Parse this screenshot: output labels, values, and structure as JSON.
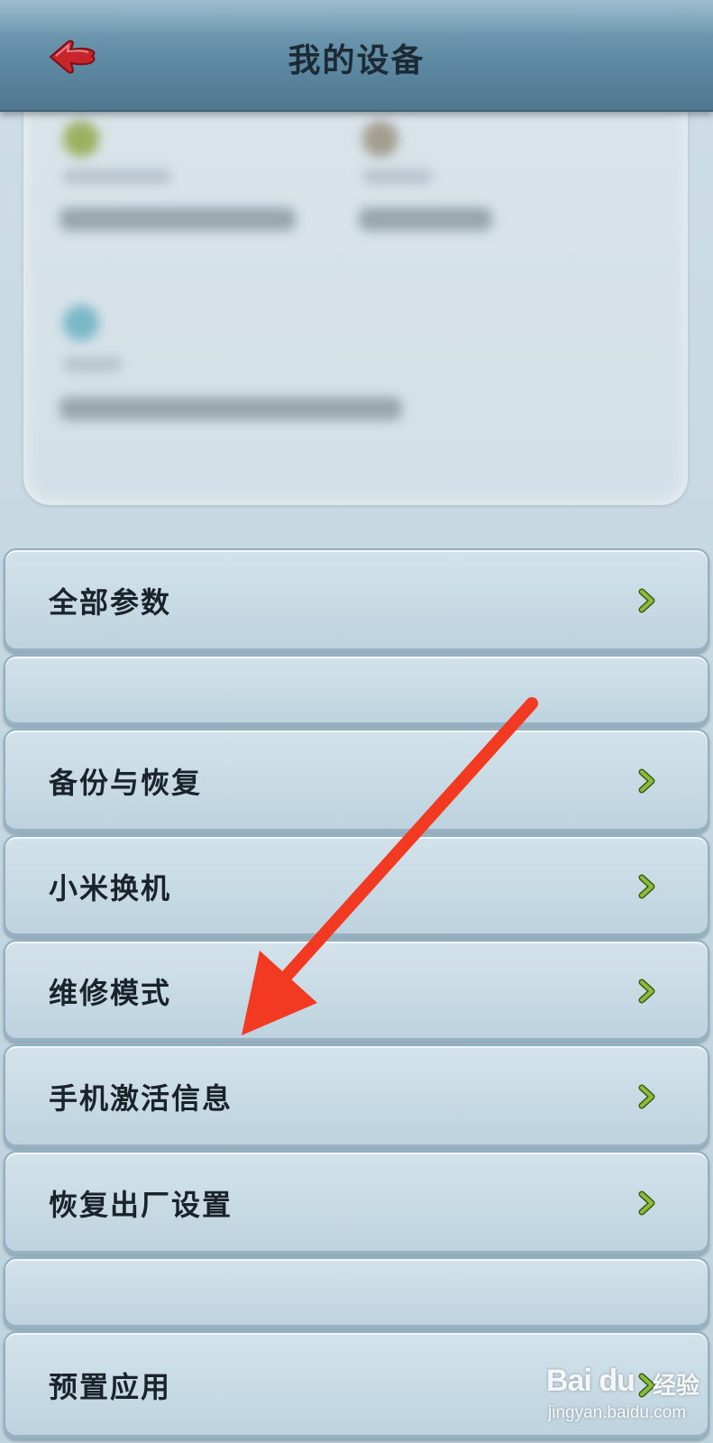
{
  "header": {
    "title": "我的设备",
    "back_icon": "back-arrow-icon",
    "accent_color": "#c8242b"
  },
  "device_card": {
    "note": ""
  },
  "menu": {
    "items": [
      {
        "label": "全部参数",
        "icon": "chevron-right-icon"
      },
      {
        "label": "",
        "icon": ""
      },
      {
        "label": "备份与恢复",
        "icon": "chevron-right-icon"
      },
      {
        "label": "小米换机",
        "icon": "chevron-right-icon"
      },
      {
        "label": "维修模式",
        "icon": "chevron-right-icon"
      },
      {
        "label": "手机激活信息",
        "icon": "chevron-right-icon"
      },
      {
        "label": "恢复出厂设置",
        "icon": "chevron-right-icon"
      },
      {
        "label": "",
        "icon": ""
      },
      {
        "label": "预置应用",
        "icon": "chevron-right-icon"
      }
    ],
    "chevron_color": "#6f9a2c"
  },
  "annotation": {
    "arrow_color": "#f23a22"
  },
  "watermark": {
    "logo": "Bai du",
    "sub": "经验",
    "url": "jingyan.baidu.com"
  }
}
